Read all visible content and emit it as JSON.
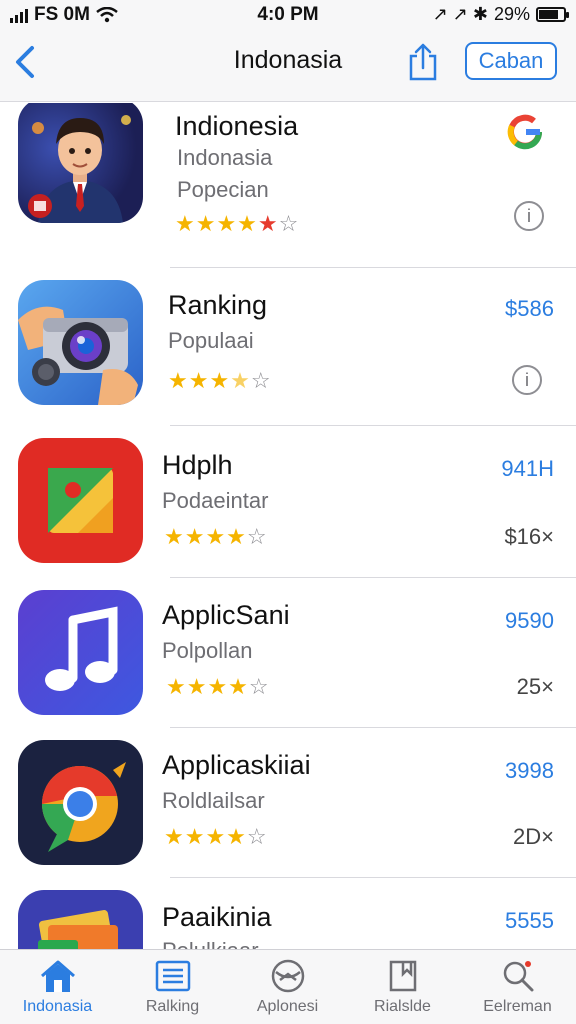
{
  "status_bar": {
    "carrier": "FS 0M",
    "time": "4:0 PM",
    "right_icons": "↗ ↗ ✱",
    "battery_percent": "29%",
    "battery_level": 0.8
  },
  "nav": {
    "title": "Indonasia",
    "cancel_label": "Caban"
  },
  "apps": [
    {
      "name": "Indionesia",
      "subtitle1": "Indonasia",
      "subtitle2": "Popecian",
      "rating": 4,
      "icon": "cartoon-avatar-icon"
    },
    {
      "name": "Ranking",
      "subtitle2": "Populaai",
      "price": "$586",
      "rating": 3.5,
      "icon": "camera-icon"
    },
    {
      "name": "Hdplh",
      "subtitle2": "Podaeintar",
      "price": "941H",
      "meta": "$16×",
      "rating": 4,
      "icon": "photo-app-icon"
    },
    {
      "name": "ApplicSani",
      "subtitle2": "Polpollan",
      "price": "9590",
      "meta": "25×",
      "rating": 4,
      "icon": "music-note-icon"
    },
    {
      "name": "Applicaskiiai",
      "subtitle2": "Roldlailsar",
      "price": "3998",
      "meta": "2D×",
      "rating": 4,
      "icon": "chrome-icon"
    },
    {
      "name": "Paaikinia",
      "subtitle2": "Polulkiaar",
      "price": "5555",
      "icon": "folder-icon"
    }
  ],
  "tabs": [
    {
      "label": "Indonasia",
      "icon": "home-icon",
      "active": true
    },
    {
      "label": "Ralking",
      "icon": "list-icon",
      "active": false
    },
    {
      "label": "Aplonesi",
      "icon": "globe-icon",
      "active": false
    },
    {
      "label": "Rialslde",
      "icon": "bookmark-icon",
      "active": false
    },
    {
      "label": "Eelreman",
      "icon": "search-icon",
      "active": false
    }
  ],
  "colors": {
    "accent": "#2b7de0",
    "star": "#f5b400",
    "background": "#ffffff",
    "bar": "#f7f7f8"
  }
}
